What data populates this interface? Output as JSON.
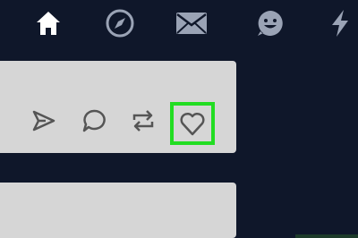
{
  "nav": {
    "items": [
      {
        "icon": "home-icon",
        "active": true
      },
      {
        "icon": "compass-icon",
        "active": false
      },
      {
        "icon": "mail-icon",
        "active": false
      },
      {
        "icon": "emoji-icon",
        "active": false
      },
      {
        "icon": "lightning-icon",
        "active": false
      }
    ]
  },
  "post": {
    "actions": [
      {
        "icon": "share-icon"
      },
      {
        "icon": "comment-icon"
      },
      {
        "icon": "repost-icon"
      },
      {
        "icon": "heart-icon",
        "highlighted": true
      }
    ]
  },
  "colors": {
    "background": "#0f172a",
    "card": "#d6d6d6",
    "active_nav_icon": "#ffffff",
    "inactive_nav_icon": "#9aa3b5",
    "action_icon": "#555555",
    "highlight": "#22dd22"
  }
}
